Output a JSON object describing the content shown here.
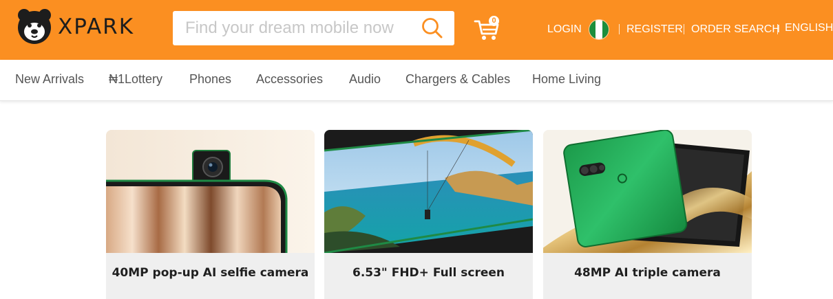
{
  "brand": {
    "name": "XPARK"
  },
  "search": {
    "placeholder": "Find your dream mobile now",
    "value": ""
  },
  "cart": {
    "count": "0"
  },
  "topnav": {
    "login": "LOGIN",
    "register": "REGISTER",
    "order_search": "ORDER SEARCH",
    "language": "ENGLISH"
  },
  "colors": {
    "header_bg": "#fb8f21",
    "flag_green": "#1b8e3c",
    "text_dark": "#1f1f1f"
  },
  "categories": [
    "New Arrivals",
    "₦1Lottery",
    "Phones",
    "Accessories",
    "Audio",
    "Chargers & Cables",
    "Home Living"
  ],
  "cards": [
    {
      "caption": "40MP pop-up AI selfie camera",
      "image": "pop-up-camera-phone"
    },
    {
      "caption": "6.53\" FHD+ Full screen",
      "image": "paraglider-ocean-screen"
    },
    {
      "caption": "48MP AI triple camera",
      "image": "green-phone-triple-camera"
    }
  ]
}
